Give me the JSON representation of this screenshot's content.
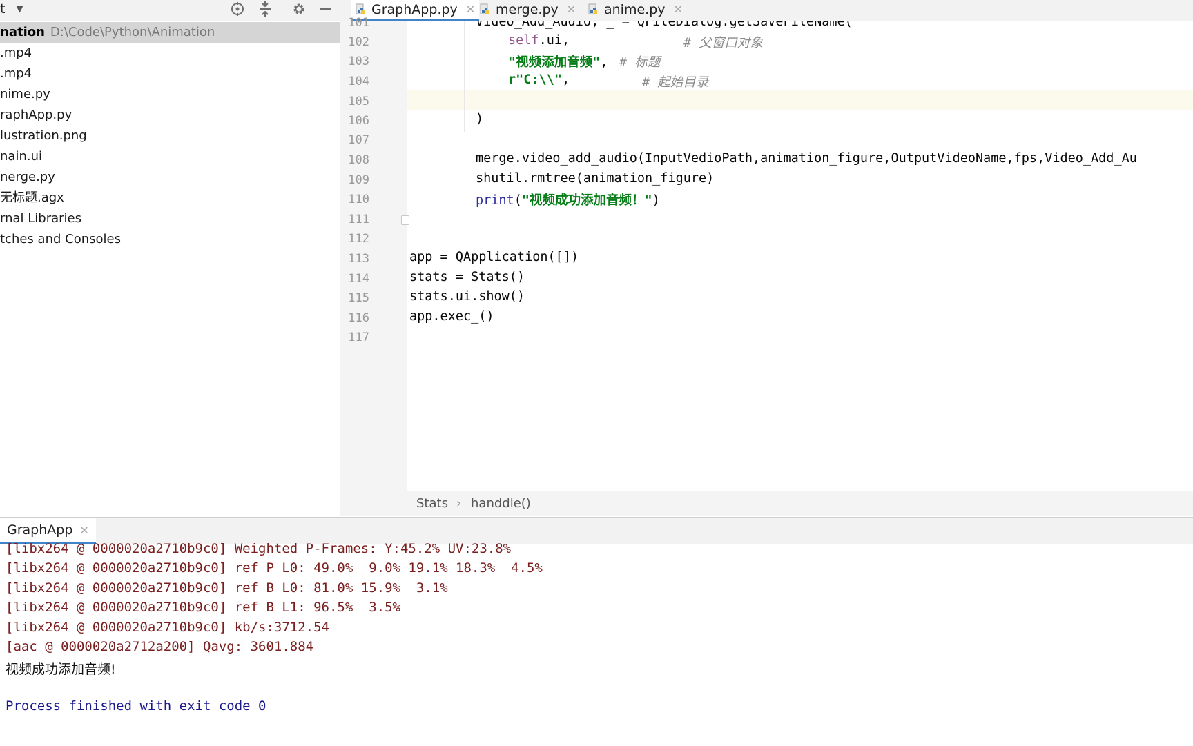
{
  "project_pane": {
    "title": "t",
    "root": {
      "name": "nation",
      "path": "D:\\Code\\Python\\Animation"
    },
    "items": [
      ".mp4",
      ".mp4",
      "nime.py",
      "raphApp.py",
      "lustration.png",
      "nain.ui",
      "nerge.py",
      "无标题.agx",
      "rnal Libraries",
      "tches and Consoles"
    ]
  },
  "editor": {
    "tabs": [
      {
        "label": "GraphApp.py",
        "active": true
      },
      {
        "label": "merge.py",
        "active": false
      },
      {
        "label": "anime.py",
        "active": false
      }
    ],
    "lines": [
      {
        "no": "101",
        "text": "Video_Add_Audio, _ = QFileDialog.getSaveFileName("
      },
      {
        "no": "102",
        "self": "self",
        "rest": ".ui,",
        "comment": "# 父窗口对象"
      },
      {
        "no": "103",
        "str": "\"视频添加音频\"",
        "rest": ",",
        "comment": "# 标题"
      },
      {
        "no": "104",
        "str": "r\"C:\\\\\"",
        "rest": ",",
        "comment": "# 起始目录"
      },
      {
        "no": "105",
        "text": ""
      },
      {
        "no": "106",
        "text": ")"
      },
      {
        "no": "107",
        "text": ""
      },
      {
        "no": "108",
        "text": "merge.video_add_audio(InputVedioPath,animation_figure,OutputVideoName,fps,Video_Add_Au"
      },
      {
        "no": "109",
        "text": "shutil.rmtree(animation_figure)"
      },
      {
        "no": "110",
        "call": "print",
        "open": "(",
        "str": "\"视频成功添加音频！\"",
        "close": ")"
      },
      {
        "no": "111",
        "text": ""
      },
      {
        "no": "112",
        "text": ""
      },
      {
        "no": "113",
        "text": "app = QApplication([])"
      },
      {
        "no": "114",
        "text": "stats = Stats()"
      },
      {
        "no": "115",
        "text": "stats.ui.show()"
      },
      {
        "no": "116",
        "text": "app.exec_()"
      },
      {
        "no": "117",
        "text": ""
      }
    ],
    "breadcrumbs": [
      "Stats",
      "handdle()"
    ],
    "breadcrumb_separator": "›"
  },
  "run_panel": {
    "tab_label": "GraphApp",
    "console": [
      {
        "text": "[libx264 @ 0000020a2710b9c0] Weighted P-Frames: Y:45.2% UV:23.8%",
        "kind": "err"
      },
      {
        "text": "[libx264 @ 0000020a2710b9c0] ref P L0: 49.0%  9.0% 19.1% 18.3%  4.5%",
        "kind": "err"
      },
      {
        "text": "[libx264 @ 0000020a2710b9c0] ref B L0: 81.0% 15.9%  3.1%",
        "kind": "err"
      },
      {
        "text": "[libx264 @ 0000020a2710b9c0] ref B L1: 96.5%  3.5%",
        "kind": "err"
      },
      {
        "text": "[libx264 @ 0000020a2710b9c0] kb/s:3712.54",
        "kind": "err"
      },
      {
        "text": "[aac @ 0000020a2712a200] Qavg: 3601.884",
        "kind": "err"
      },
      {
        "text": "视频成功添加音频!",
        "kind": "normal"
      },
      {
        "text": "",
        "kind": "normal"
      },
      {
        "text": "Process finished with exit code 0",
        "kind": "exit"
      }
    ]
  },
  "colors": {
    "accent": "#4083c9",
    "string": "#067d17",
    "comment": "#8c8c8c",
    "self_keyword": "#94558d",
    "console_error": "#7a1f1f",
    "current_line": "#fcfaed"
  }
}
